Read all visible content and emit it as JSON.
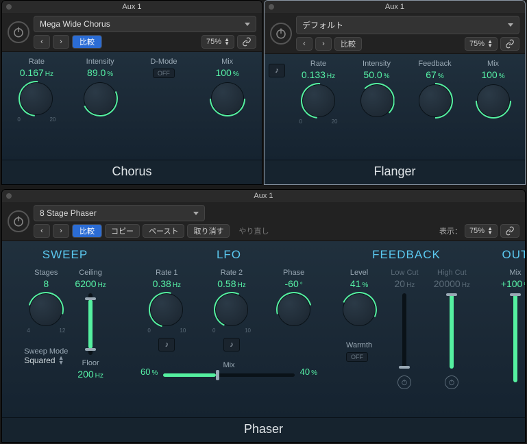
{
  "chorus": {
    "title": "Aux 1",
    "preset": "Mega Wide Chorus",
    "compare": "比較",
    "zoom": "75%",
    "footer": "Chorus",
    "params": {
      "rate": {
        "label": "Rate",
        "value": "0.167",
        "unit": "Hz",
        "scale_min": "0",
        "scale_max": "20"
      },
      "intensity": {
        "label": "Intensity",
        "value": "89.0",
        "unit": "%"
      },
      "dmode": {
        "label": "D-Mode",
        "value": "OFF"
      },
      "mix": {
        "label": "Mix",
        "value": "100",
        "unit": "%"
      }
    }
  },
  "flanger": {
    "title": "Aux 1",
    "preset": "デフォルト",
    "compare": "比較",
    "zoom": "75%",
    "footer": "Flanger",
    "params": {
      "rate": {
        "label": "Rate",
        "value": "0.133",
        "unit": "Hz",
        "scale_min": "0",
        "scale_max": "20"
      },
      "intensity": {
        "label": "Intensity",
        "value": "50.0",
        "unit": "%"
      },
      "feedback": {
        "label": "Feedback",
        "value": "67",
        "unit": "%"
      },
      "mix": {
        "label": "Mix",
        "value": "100",
        "unit": "%"
      }
    }
  },
  "phaser": {
    "title": "Aux 1",
    "preset": "8 Stage Phaser",
    "compare": "比較",
    "copy": "コピー",
    "paste": "ペースト",
    "undo": "取り消す",
    "redo": "やり直し",
    "show_label": "表示：",
    "zoom": "75%",
    "footer": "Phaser",
    "sections": {
      "sweep": "SWEEP",
      "lfo": "LFO",
      "feedback": "FEEDBACK",
      "out": "OUT"
    },
    "sweep": {
      "stages": {
        "label": "Stages",
        "value": "8",
        "scale_min": "4",
        "scale_max": "12"
      },
      "ceiling": {
        "label": "Ceiling",
        "value": "6200",
        "unit": "Hz"
      },
      "floor": {
        "label": "Floor",
        "value": "200",
        "unit": "Hz"
      },
      "mode_label": "Sweep Mode",
      "mode_value": "Squared"
    },
    "lfo": {
      "rate1": {
        "label": "Rate 1",
        "value": "0.38",
        "unit": "Hz",
        "scale_min": "0",
        "scale_max": "10"
      },
      "rate2": {
        "label": "Rate 2",
        "value": "0.58",
        "unit": "Hz",
        "scale_min": "0",
        "scale_max": "10"
      },
      "phase": {
        "label": "Phase",
        "value": "-60",
        "unit": "°"
      },
      "mix1": {
        "value": "60",
        "unit": "%"
      },
      "mix_label": "Mix",
      "mix2": {
        "value": "40",
        "unit": "%"
      }
    },
    "feedback": {
      "level": {
        "label": "Level",
        "value": "41",
        "unit": "%"
      },
      "lowcut": {
        "label": "Low Cut",
        "value": "20",
        "unit": "Hz"
      },
      "highcut": {
        "label": "High Cut",
        "value": "20000",
        "unit": "Hz"
      },
      "warmth_label": "Warmth",
      "warmth_value": "OFF"
    },
    "out": {
      "mix": {
        "label": "Mix",
        "value": "+100",
        "unit": "%"
      }
    }
  }
}
